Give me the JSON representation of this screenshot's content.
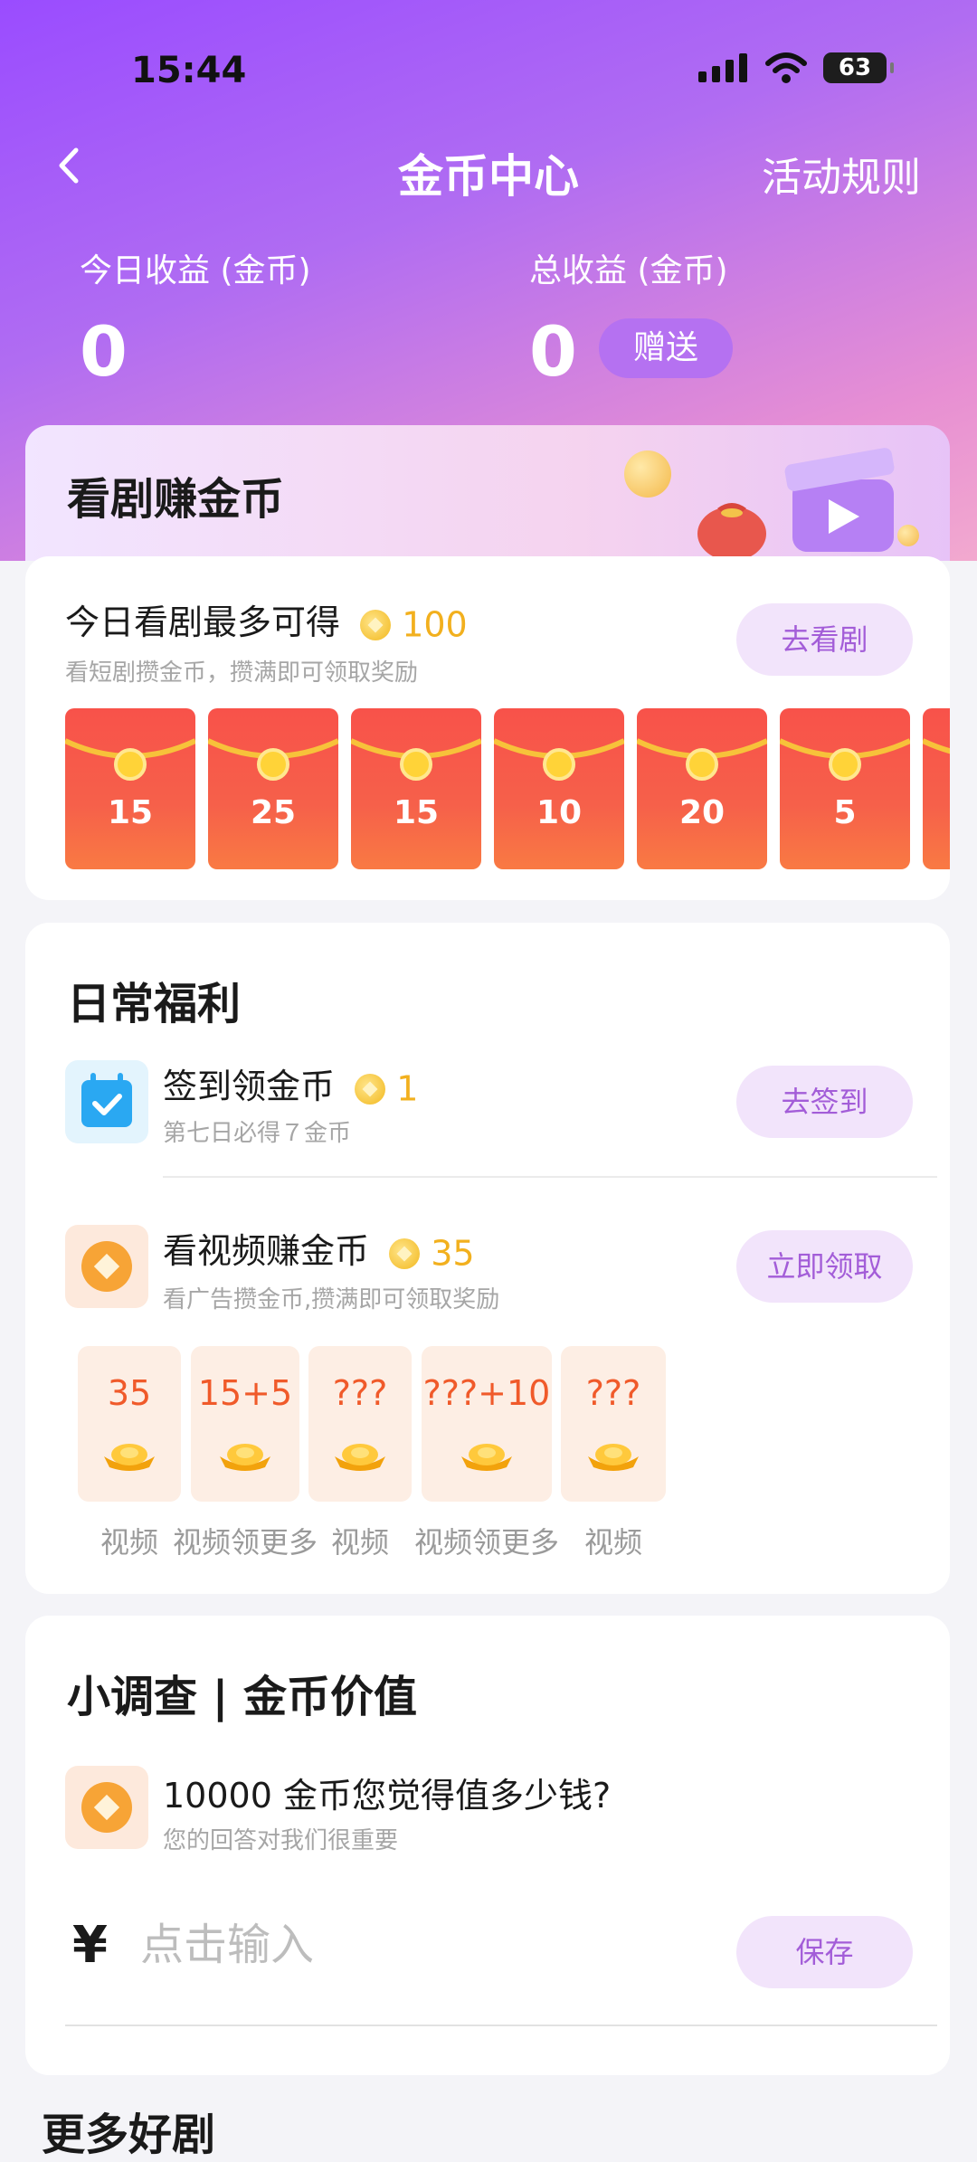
{
  "status_bar": {
    "time": "15:44",
    "battery": "63"
  },
  "nav": {
    "title": "金币中心",
    "rules": "活动规则"
  },
  "earnings": {
    "today_label": "今日收益 (金币)",
    "today_value": "0",
    "total_label": "总收益 (金币)",
    "total_value": "0",
    "gift_label": "赠送"
  },
  "drama": {
    "title": "看剧赚金币",
    "row_title": "今日看剧最多可得",
    "row_amount": "100",
    "row_sub": "看短剧攒金币，攒满即可领取奖励",
    "button": "去看剧",
    "envelopes": [
      "15",
      "25",
      "15",
      "10",
      "20",
      "5"
    ]
  },
  "daily": {
    "title": "日常福利",
    "checkin": {
      "title": "签到领金币",
      "amount": "1",
      "sub": "第七日必得７金币",
      "button": "去签到"
    },
    "video": {
      "title": "看视频赚金币",
      "amount": "35",
      "sub": "看广告攒金币,攒满即可领取奖励",
      "button": "立即领取"
    },
    "tiles": [
      {
        "value": "35",
        "label": "视频"
      },
      {
        "value": "15+5",
        "label": "视频领更多"
      },
      {
        "value": "???",
        "label": "视频"
      },
      {
        "value": "???+10",
        "label": "视频领更多"
      },
      {
        "value": "???",
        "label": "视频"
      }
    ]
  },
  "survey": {
    "title": "小调查 | 金币价值",
    "question": "10000 金币您觉得值多少钱?",
    "sub": "您的回答对我们很重要",
    "currency": "¥",
    "input_placeholder": "点击输入",
    "button": "保存"
  },
  "more_title": "更多好剧",
  "colors": {
    "accent_purple": "#a35dd8",
    "envelope_red": "#f8524a",
    "coin_gold": "#f2b01e",
    "tile_orange": "#f05a2a"
  }
}
